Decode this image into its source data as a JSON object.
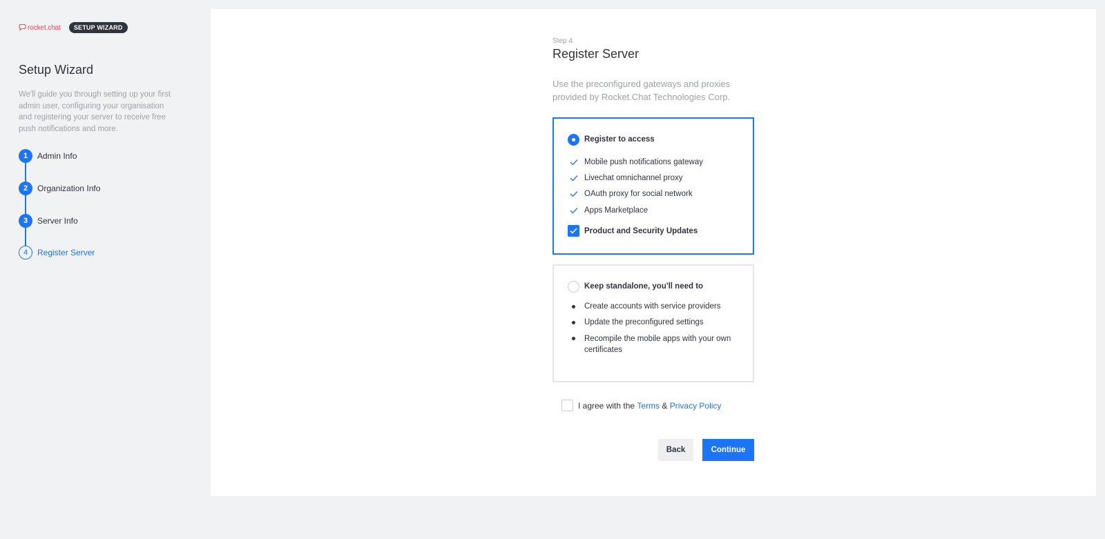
{
  "brand": {
    "logo_text": "rocket.chat",
    "badge": "SETUP WIZARD"
  },
  "sidebar": {
    "title": "Setup Wizard",
    "description": "We'll guide you through setting up your first admin user, configuring your organisation and registering your server to receive free push notifications and more.",
    "steps": [
      {
        "number": "1",
        "label": "Admin Info",
        "status": "done"
      },
      {
        "number": "2",
        "label": "Organization Info",
        "status": "done"
      },
      {
        "number": "3",
        "label": "Server Info",
        "status": "done"
      },
      {
        "number": "4",
        "label": "Register Server",
        "status": "current"
      }
    ]
  },
  "main": {
    "step_label": "Step 4",
    "title": "Register Server",
    "intro": "Use the preconfigured gateways and proxies provided by Rocket.Chat Technologies Corp.",
    "register_option": {
      "title": "Register to access",
      "selected": true,
      "features": [
        "Mobile push notifications gateway",
        "Livechat omnichannel proxy",
        "OAuth proxy for social network",
        "Apps Marketplace"
      ],
      "updates_label": "Product and Security Updates",
      "updates_checked": true
    },
    "standalone_option": {
      "title": "Keep standalone, you'll need to",
      "selected": false,
      "items": [
        "Create accounts with service providers",
        "Update the preconfigured settings",
        "Recompile the mobile apps with your own certificates"
      ]
    },
    "agree": {
      "prefix": "I agree with the ",
      "terms": "Terms",
      "ampersand": " & ",
      "privacy": "Privacy Policy",
      "checked": false
    },
    "buttons": {
      "back": "Back",
      "continue": "Continue"
    }
  },
  "colors": {
    "accent": "#1d74f5",
    "brand": "#f5455c",
    "text": "#2f343d",
    "muted": "#9ea2a8"
  },
  "icons": [
    "rocket-logo-icon",
    "check-icon",
    "checkbox-check-icon"
  ]
}
